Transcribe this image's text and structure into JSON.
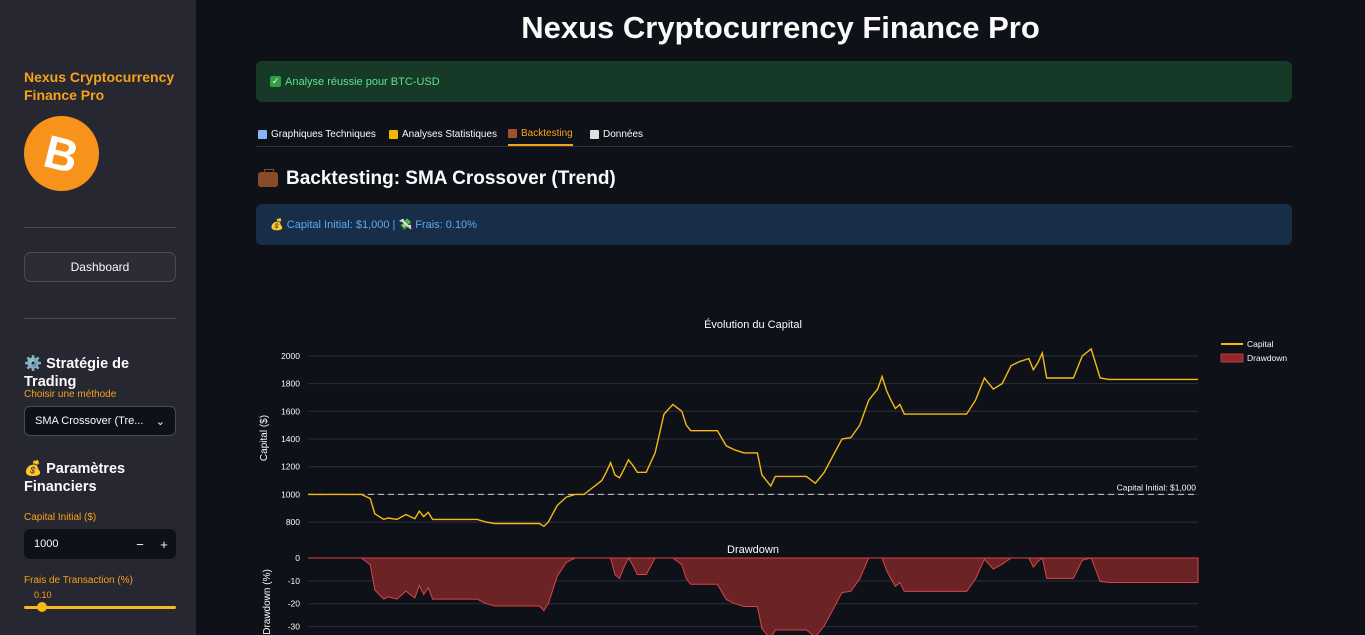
{
  "sidebar": {
    "title": "Nexus Cryptocurrency Finance Pro",
    "logo_symbol": "B",
    "dashboard_button": "Dashboard",
    "strategy_heading": "⚙️ Stratégie de Trading",
    "method_label": "Choisir une méthode",
    "method_value": "SMA Crossover (Tre...",
    "finance_heading": "💰 Paramètres Financiers",
    "capital_label": "Capital Initial ($)",
    "capital_value": "1000",
    "minus": "−",
    "plus": "+",
    "fees_label": "Frais de Transaction (%)",
    "fees_value": "0.10",
    "chevron": "⌄"
  },
  "header": {
    "title": "Nexus Cryptocurrency Finance Pro"
  },
  "success_message": "Analyse réussie pour BTC-USD",
  "tabs": [
    {
      "label": "Graphiques Techniques",
      "icon": "chart-line-icon",
      "color": "#8ab4f8"
    },
    {
      "label": "Analyses Statistiques",
      "icon": "bar-chart-icon",
      "color": "#f4b400"
    },
    {
      "label": "Backtesting",
      "icon": "briefcase-icon",
      "color": "#a0522d"
    },
    {
      "label": "Données",
      "icon": "document-icon",
      "color": "#e0e0e0"
    }
  ],
  "active_tab": "Backtesting",
  "section_heading": "Backtesting: SMA Crossover (Trend)",
  "info_text": "💰 Capital Initial: $1,000 | 💸 Frais: 0.10%",
  "colors": {
    "accent": "#f7a21b",
    "capital_line": "#f5b915",
    "drawdown": "#c0393b"
  },
  "chart_data": [
    {
      "type": "line",
      "title": "Évolution du Capital",
      "ylabel": "Capital ($)",
      "ylim": [
        700,
        2100
      ],
      "yticks": [
        800,
        1000,
        1200,
        1400,
        1600,
        1800,
        2000
      ],
      "series": [
        {
          "name": "Capital",
          "x": [
            0,
            2,
            4,
            5,
            6,
            8,
            10,
            11,
            12,
            14,
            15,
            17,
            18,
            20,
            22,
            24,
            25,
            26,
            27,
            28,
            30,
            32,
            34,
            36,
            38,
            40,
            42,
            44,
            45,
            46,
            47,
            48,
            49,
            50,
            51,
            52,
            53,
            54,
            56,
            58,
            60,
            62,
            64,
            66,
            67,
            68,
            69,
            70,
            71,
            72,
            73,
            74,
            75,
            76,
            78,
            80,
            82,
            84,
            85,
            86,
            87,
            88,
            89,
            90,
            92,
            94,
            96,
            98,
            99,
            100,
            101,
            102,
            103,
            104,
            105,
            106,
            108,
            110,
            112,
            114,
            116,
            118,
            120,
            122,
            124,
            126,
            128,
            129,
            130,
            131,
            132,
            133,
            134,
            136,
            138,
            140,
            141,
            142,
            143,
            144,
            145,
            146,
            148,
            150,
            152,
            154,
            156,
            158,
            160,
            162,
            163,
            164,
            165,
            166,
            168,
            170,
            172,
            174,
            176,
            178,
            180,
            182,
            184,
            186,
            188,
            190,
            192,
            194,
            196,
            198,
            200
          ],
          "values": [
            1000,
            1000,
            1000,
            1000,
            1000,
            1000,
            1000,
            1000,
            1000,
            970,
            860,
            820,
            830,
            820,
            855,
            825,
            880,
            840,
            870,
            820,
            820,
            820,
            820,
            820,
            820,
            800,
            790,
            790,
            790,
            790,
            790,
            790,
            790,
            790,
            790,
            790,
            770,
            800,
            920,
            980,
            1000,
            1000,
            1050,
            1100,
            1160,
            1230,
            1140,
            1120,
            1180,
            1250,
            1210,
            1160,
            1160,
            1160,
            1300,
            1580,
            1650,
            1600,
            1500,
            1460,
            1460,
            1460,
            1460,
            1460,
            1460,
            1350,
            1320,
            1300,
            1300,
            1300,
            1300,
            1140,
            1100,
            1060,
            1130,
            1130,
            1130,
            1130,
            1130,
            1080,
            1160,
            1280,
            1400,
            1410,
            1500,
            1680,
            1760,
            1850,
            1750,
            1680,
            1620,
            1650,
            1580,
            1580,
            1580,
            1580,
            1580,
            1580,
            1580,
            1580,
            1580,
            1580,
            1580,
            1680,
            1840,
            1760,
            1800,
            1930,
            1960,
            1980,
            1900,
            1950,
            2020,
            1840,
            1840,
            1840,
            1840,
            2000,
            2050,
            1840,
            1830,
            1830,
            1830,
            1830,
            1830,
            1830,
            1830,
            1830,
            1830,
            1830,
            1830
          ]
        }
      ],
      "reference_line": {
        "value": 1000,
        "label": "Capital Initial: $1,000"
      },
      "legend": [
        "Capital",
        "Drawdown"
      ],
      "legend_position": "top-right",
      "grid": true
    },
    {
      "type": "area",
      "title": "Drawdown",
      "ylabel": "Drawdown (%)",
      "ylim": [
        -35,
        0
      ],
      "yticks": [
        0,
        -10,
        -20,
        -30
      ],
      "grid": true
    }
  ]
}
